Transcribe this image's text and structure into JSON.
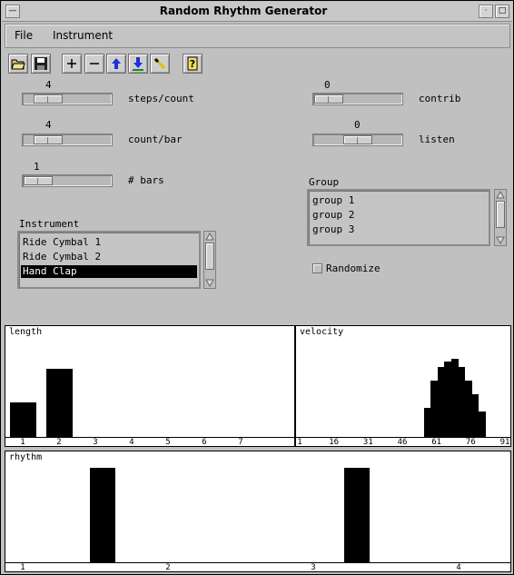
{
  "window": {
    "title": "Random Rhythm Generator"
  },
  "menu": {
    "file": "File",
    "instrument": "Instrument"
  },
  "toolbar": {
    "icons": [
      "open-folder-icon",
      "save-disk-icon",
      "plus-icon",
      "minus-icon",
      "arrow-up-icon",
      "arrow-down-icon",
      "pencil-icon",
      "help-icon"
    ]
  },
  "sliders": {
    "steps_per_count": {
      "value": "4",
      "label": "steps/count"
    },
    "count_per_bar": {
      "value": "4",
      "label": "count/bar"
    },
    "bars": {
      "value": "1",
      "label": "# bars"
    },
    "contrib": {
      "value": "0",
      "label": "contrib"
    },
    "listen": {
      "value": "0",
      "label": "listen"
    }
  },
  "instrument": {
    "label": "Instrument",
    "items": [
      "Ride Cymbal 1",
      "Ride Cymbal 2",
      "Hand Clap"
    ],
    "selected": "Hand Clap"
  },
  "group": {
    "label": "Group",
    "items": [
      "group 1",
      "group 2",
      "group 3"
    ]
  },
  "randomize": {
    "label": "Randomize",
    "checked": false
  },
  "chart_data": [
    {
      "type": "bar",
      "title": "length",
      "categories": [
        "1",
        "2",
        "3",
        "4",
        "5",
        "6",
        "7"
      ],
      "values": [
        0.37,
        0.72,
        0,
        0,
        0,
        0,
        0
      ],
      "ylim": [
        0,
        1
      ]
    },
    {
      "type": "bar",
      "title": "velocity",
      "tick_labels": [
        "1",
        "16",
        "31",
        "46",
        "61",
        "76",
        "91"
      ],
      "x": [
        57,
        60,
        63,
        66,
        69,
        72,
        75,
        78,
        81,
        84,
        87
      ],
      "values": [
        0.31,
        0.6,
        0.74,
        0.8,
        0.83,
        0.74,
        0.6,
        0.45,
        0.27,
        0,
        0
      ],
      "xlim": [
        1,
        91
      ],
      "ylim": [
        0,
        1
      ]
    },
    {
      "type": "bar",
      "title": "rhythm",
      "tick_labels": [
        "1",
        "2",
        "3",
        "4"
      ],
      "x": [
        1.5,
        3.25
      ],
      "values": [
        1,
        1
      ],
      "xlim": [
        1,
        4.3
      ],
      "ylim": [
        0,
        1
      ]
    }
  ]
}
